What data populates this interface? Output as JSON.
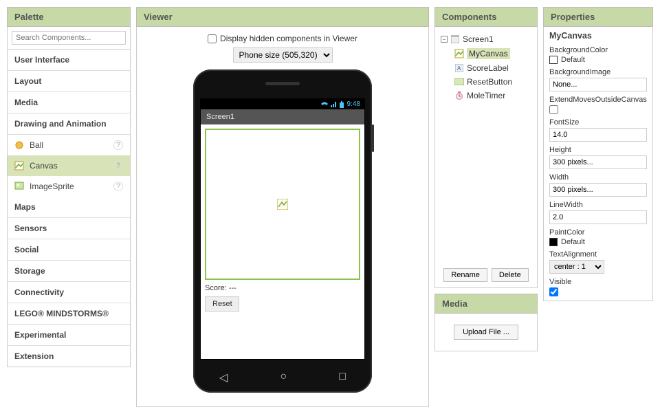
{
  "palette": {
    "title": "Palette",
    "search_placeholder": "Search Components...",
    "categories": [
      "User Interface",
      "Layout",
      "Media",
      "Drawing and Animation",
      "Maps",
      "Sensors",
      "Social",
      "Storage",
      "Connectivity",
      "LEGO® MINDSTORMS®",
      "Experimental",
      "Extension"
    ],
    "open_index": 3,
    "draw_items": [
      "Ball",
      "Canvas",
      "ImageSprite"
    ]
  },
  "viewer": {
    "title": "Viewer",
    "show_hidden_label": "Display hidden components in Viewer",
    "size_select": "Phone size (505,320)",
    "status_time": "9:48",
    "screen_title": "Screen1",
    "score_label": "Score: ---",
    "reset_label": "Reset"
  },
  "components": {
    "title": "Components",
    "root": "Screen1",
    "children": [
      "MyCanvas",
      "ScoreLabel",
      "ResetButton",
      "MoleTimer"
    ],
    "selected": "MyCanvas",
    "rename": "Rename",
    "delete": "Delete"
  },
  "media": {
    "title": "Media",
    "upload": "Upload File ..."
  },
  "properties": {
    "title": "Properties",
    "component": "MyCanvas",
    "labels": {
      "bgcolor": "BackgroundColor",
      "bgcolor_val": "Default",
      "bgimage": "BackgroundImage",
      "bgimage_val": "None...",
      "extend": "ExtendMovesOutsideCanvas",
      "fontsize": "FontSize",
      "fontsize_val": "14.0",
      "height": "Height",
      "height_val": "300 pixels...",
      "width": "Width",
      "width_val": "300 pixels...",
      "linewidth": "LineWidth",
      "linewidth_val": "2.0",
      "paintcolor": "PaintColor",
      "paintcolor_val": "Default",
      "textalign": "TextAlignment",
      "textalign_val": "center : 1",
      "visible": "Visible"
    }
  }
}
